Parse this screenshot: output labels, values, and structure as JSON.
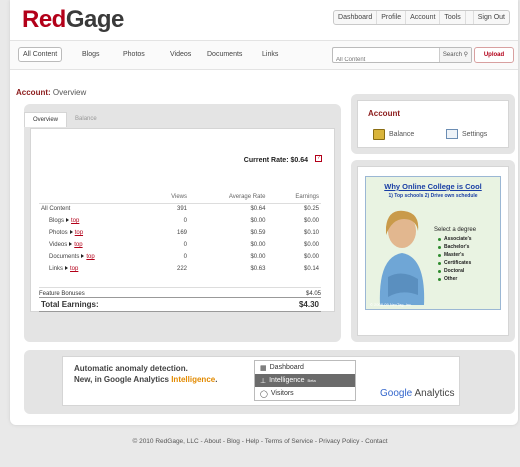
{
  "brand": {
    "part1": "Red",
    "part2": "Gage"
  },
  "topnav": [
    "Dashboard",
    "Profile",
    "Account",
    "Tools",
    "Sign Out"
  ],
  "categories": [
    "All Content",
    "Blogs",
    "Photos",
    "Videos",
    "Documents",
    "Links"
  ],
  "search": {
    "placeholder": "All Content",
    "button": "Search"
  },
  "upload_label": "Upload",
  "breadcrumb": {
    "section": "Account:",
    "page": "Overview"
  },
  "tabs": [
    "Overview",
    "Balance"
  ],
  "current_rate": "Current Rate: $0.64",
  "table": {
    "headers": [
      "",
      "Views",
      "Average Rate",
      "Earnings"
    ],
    "rows": [
      {
        "label": "All Content",
        "link": "",
        "views": "391",
        "rate": "$0.64",
        "earnings": "$0.25"
      },
      {
        "label": "Blogs",
        "link": "top",
        "views": "0",
        "rate": "$0.00",
        "earnings": "$0.00"
      },
      {
        "label": "Photos",
        "link": "top",
        "views": "169",
        "rate": "$0.59",
        "earnings": "$0.10"
      },
      {
        "label": "Videos",
        "link": "top",
        "views": "0",
        "rate": "$0.00",
        "earnings": "$0.00"
      },
      {
        "label": "Documents",
        "link": "top",
        "views": "0",
        "rate": "$0.00",
        "earnings": "$0.00"
      },
      {
        "label": "Links",
        "link": "top",
        "views": "222",
        "rate": "$0.63",
        "earnings": "$0.14"
      }
    ]
  },
  "bonuses": {
    "label": "Feature Bonuses",
    "value": "$4.05"
  },
  "total": {
    "label": "Total Earnings:",
    "value": "$4.30"
  },
  "account": {
    "title": "Account",
    "balance": "Balance",
    "settings": "Settings"
  },
  "ad": {
    "title": "Why Online College is Cool",
    "subtitle": "1) Top schools  2) Drive own schedule",
    "select": "Select a degree",
    "degrees": [
      "Associate's",
      "Bachelor's",
      "Master's",
      "Certificates",
      "Doctoral",
      "Other"
    ],
    "copyright": "© 2008-09 NexTag, Inc."
  },
  "ga": {
    "line1": "Automatic anomaly detection.",
    "line2": "New, in Google Analytics ",
    "intel": "Intelligence",
    "line2_end": ".",
    "menu": [
      "Dashboard",
      "Intelligence",
      "Visitors"
    ],
    "beta": "Beta",
    "logo1": "Google",
    "logo2": " Analytics"
  },
  "footer": "© 2010 RedGage, LLC - About - Blog - Help - Terms of Service - Privacy Policy - Contact",
  "colors": {
    "brand_red": "#b30019",
    "panel_gray": "#e4e4e4"
  }
}
